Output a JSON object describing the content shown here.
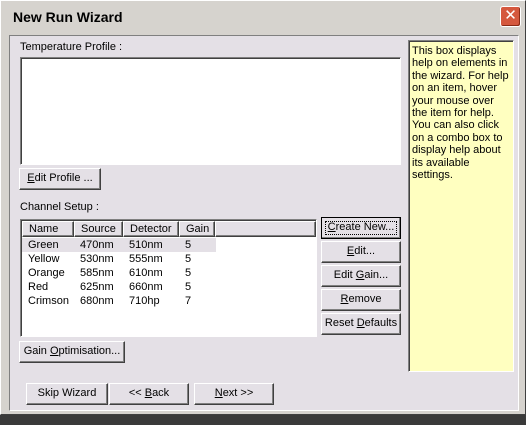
{
  "window": {
    "title": "New Run Wizard",
    "close_glyph": "✕"
  },
  "temperature_profile": {
    "label": "Temperature Profile :",
    "edit_button": {
      "pre": "",
      "key": "E",
      "post": "dit Profile ..."
    }
  },
  "help": {
    "text": "This box displays help on elements in the wizard. For help on an item, hover your mouse over the item for help. You can also click on a combo box to display help about its available settings."
  },
  "channel_setup": {
    "label": "Channel Setup :",
    "columns": [
      "Name",
      "Source",
      "Detector",
      "Gain"
    ],
    "rows": [
      {
        "name": "Green",
        "source": "470nm",
        "detector": "510nm",
        "gain": "5"
      },
      {
        "name": "Yellow",
        "source": "530nm",
        "detector": "555nm",
        "gain": "5"
      },
      {
        "name": "Orange",
        "source": "585nm",
        "detector": "610nm",
        "gain": "5"
      },
      {
        "name": "Red",
        "source": "625nm",
        "detector": "660nm",
        "gain": "5"
      },
      {
        "name": "Crimson",
        "source": "680nm",
        "detector": "710hp",
        "gain": "7"
      }
    ],
    "buttons": {
      "create_new": {
        "pre": "",
        "key": "C",
        "post": "reate New..."
      },
      "edit": {
        "pre": "",
        "key": "E",
        "post": "dit..."
      },
      "edit_gain": {
        "pre": "Edit ",
        "key": "G",
        "post": "ain..."
      },
      "remove": {
        "pre": "",
        "key": "R",
        "post": "emove"
      },
      "reset_defaults": {
        "pre": "Reset ",
        "key": "D",
        "post": "efaults"
      }
    },
    "gain_optimisation": {
      "pre": "Gain ",
      "key": "O",
      "post": "ptimisation..."
    }
  },
  "footer": {
    "skip_wizard": "Skip Wizard",
    "back": {
      "pre": "<< ",
      "key": "B",
      "post": "ack"
    },
    "next": {
      "pre": "",
      "key": "N",
      "post": "ext >>"
    }
  }
}
